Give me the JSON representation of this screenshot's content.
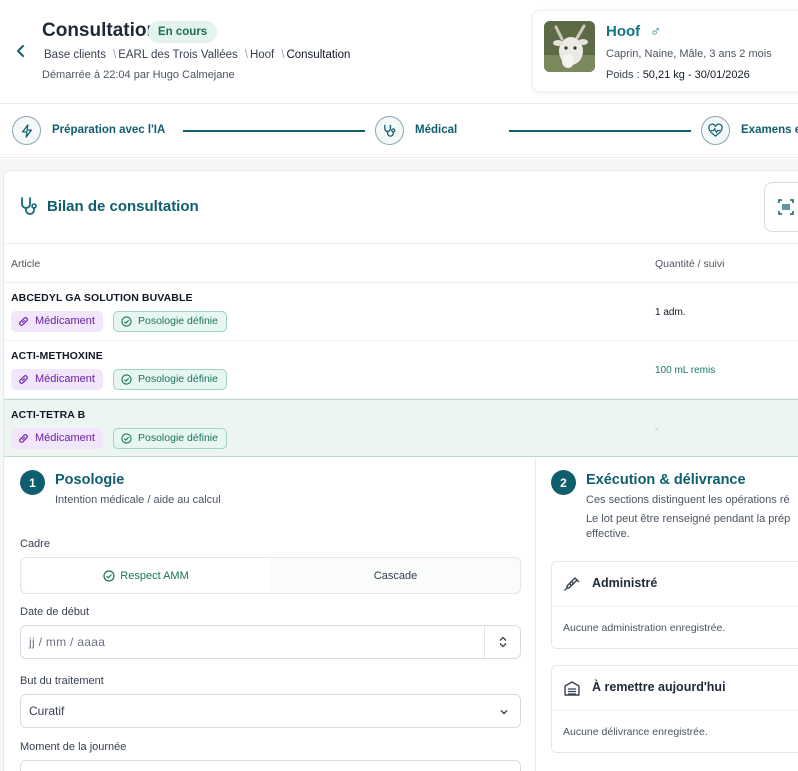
{
  "header": {
    "title": "Consultation",
    "status": "En cours",
    "breadcrumb": [
      "Base clients",
      "EARL des Trois Vallées",
      "Hoof",
      "Consultation"
    ],
    "started": "Démarrée à 22:04 par Hugo Calmejane"
  },
  "patient": {
    "name": "Hoof",
    "sex_symbol": "♂",
    "description": "Caprin, Naine, Mâle, 3 ans 2 mois",
    "weight_label": "Poids : ",
    "weight_value": "50,21 kg - 30/01/2026"
  },
  "stepper": {
    "steps": [
      {
        "label": "Préparation avec l'IA",
        "icon": "bolt-icon"
      },
      {
        "label": "Médical",
        "icon": "stethoscope-icon"
      },
      {
        "label": "Examens et",
        "icon": "heart-pulse-icon"
      }
    ]
  },
  "bilan": {
    "title": "Bilan de consultation",
    "columns": {
      "article": "Article",
      "quantity": "Quantité / suivi"
    },
    "rows": [
      {
        "name": "ABCEDYL GA SOLUTION BUVABLE",
        "type": "Médicament",
        "posologie": "Posologie définie",
        "quantity": "1 adm."
      },
      {
        "name": "ACTI-METHOXINE",
        "type": "Médicament",
        "posologie": "Posologie définie",
        "quantity": "100 mL remis"
      },
      {
        "name": "ACTI-TETRA B",
        "type": "Médicament",
        "posologie": "Posologie définie",
        "quantity": "-"
      }
    ]
  },
  "posologie": {
    "number": "1",
    "title": "Posologie",
    "subtitle": "Intention médicale / aide au calcul",
    "cadre_label": "Cadre",
    "cadre_options": [
      "Respect AMM",
      "Cascade"
    ],
    "cadre_selected": "Respect AMM",
    "date_label": "Date de début",
    "date_placeholder": "jj / mm / aaaa",
    "but_label": "But du traitement",
    "but_value": "Curatif",
    "moment_label": "Moment de la journée"
  },
  "execution": {
    "number": "2",
    "title": "Exécution & délivrance",
    "line1": "Ces sections distinguent les opérations ré",
    "line2": "Le lot peut être renseigné pendant la prép",
    "line3": "effective.",
    "cards": [
      {
        "title": "Administré",
        "empty": "Aucune administration enregistrée.",
        "icon": "syringe-icon"
      },
      {
        "title": "À remettre aujourd'hui",
        "empty": "Aucune délivrance enregistrée.",
        "icon": "package-icon"
      }
    ]
  },
  "colors": {
    "primary": "#0f5e6e",
    "accent_green": "#17735e",
    "purple": "#6b21a8"
  }
}
